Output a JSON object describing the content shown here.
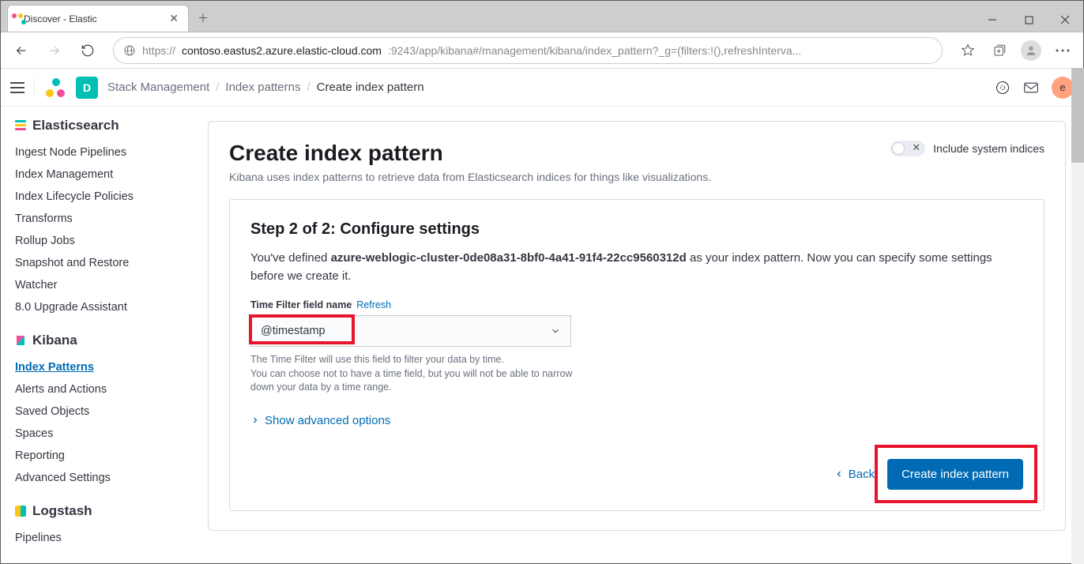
{
  "browser": {
    "tab_title": "Discover - Elastic",
    "url_scheme": "https://",
    "url_host": "contoso.eastus2.azure.elastic-cloud.com",
    "url_port_path": ":9243/app/kibana#/management/kibana/index_pattern?_g=(filters:!(),refreshInterva..."
  },
  "header": {
    "badge": "D",
    "breadcrumbs": [
      "Stack Management",
      "Index patterns",
      "Create index pattern"
    ],
    "avatar": "e"
  },
  "sidebar": {
    "sections": [
      {
        "title": "Elasticsearch",
        "items": [
          "Ingest Node Pipelines",
          "Index Management",
          "Index Lifecycle Policies",
          "Transforms",
          "Rollup Jobs",
          "Snapshot and Restore",
          "Watcher",
          "8.0 Upgrade Assistant"
        ],
        "active": -1
      },
      {
        "title": "Kibana",
        "items": [
          "Index Patterns",
          "Alerts and Actions",
          "Saved Objects",
          "Spaces",
          "Reporting",
          "Advanced Settings"
        ],
        "active": 0
      },
      {
        "title": "Logstash",
        "items": [
          "Pipelines"
        ],
        "active": -1
      }
    ]
  },
  "main": {
    "title": "Create index pattern",
    "subtitle": "Kibana uses index patterns to retrieve data from Elasticsearch indices for things like visualizations.",
    "toggle_label": "Include system indices",
    "step_title": "Step 2 of 2: Configure settings",
    "desc_pre": "You've defined ",
    "desc_bold": "azure-weblogic-cluster-0de08a31-8bf0-4a41-91f4-22cc9560312d",
    "desc_post": " as your index pattern. Now you can specify some settings before we create it.",
    "field_label": "Time Filter field name",
    "refresh_link": "Refresh",
    "select_value": "@timestamp",
    "help1": "The Time Filter will use this field to filter your data by time.",
    "help2": "You can choose not to have a time field, but you will not be able to narrow down your data by a time range.",
    "adv_link": "Show advanced options",
    "back_btn": "Back",
    "create_btn": "Create index pattern"
  }
}
